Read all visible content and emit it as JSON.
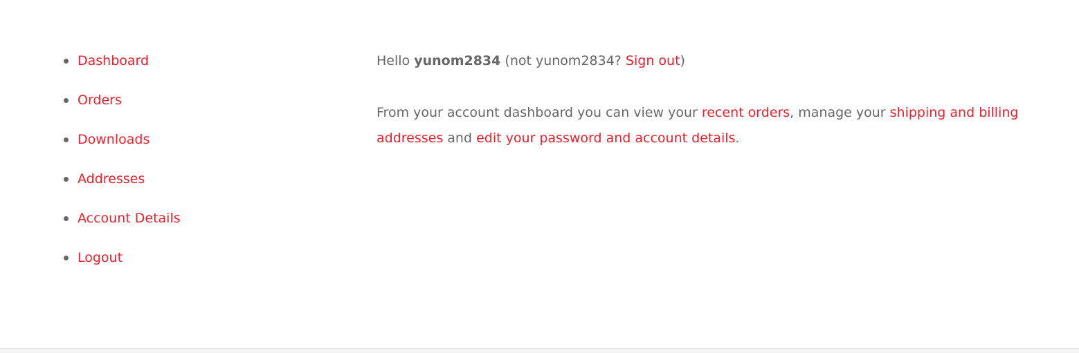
{
  "nav": {
    "items": [
      {
        "label": "Dashboard"
      },
      {
        "label": "Orders"
      },
      {
        "label": "Downloads"
      },
      {
        "label": "Addresses"
      },
      {
        "label": "Account Details"
      },
      {
        "label": "Logout"
      }
    ]
  },
  "content": {
    "greeting": {
      "hello": "Hello ",
      "username": "yunom2834",
      "not_prefix": " (not yunom2834? ",
      "sign_out": "Sign out",
      "suffix": ")"
    },
    "description": {
      "part1": "From your account dashboard you can view your ",
      "recent_orders": "recent orders",
      "part2": ", manage your ",
      "addresses_link": "shipping and billing addresses",
      "part3": " and ",
      "account_link": "edit your password and account details",
      "part4": "."
    }
  },
  "colors": {
    "accent": "#e8222e",
    "text": "#666666"
  }
}
